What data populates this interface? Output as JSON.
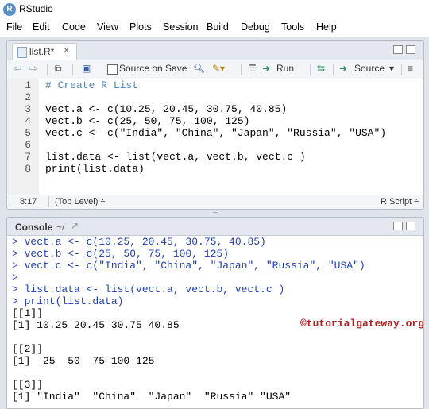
{
  "app": {
    "title": "RStudio",
    "icon_letter": "R"
  },
  "menu": [
    "File",
    "Edit",
    "Code",
    "View",
    "Plots",
    "Session",
    "Build",
    "Debug",
    "Tools",
    "Help"
  ],
  "editor": {
    "tab_label": "list.R*",
    "toolbar": {
      "source_on_save": "Source on Save",
      "run": "Run",
      "source": "Source"
    },
    "line_numbers": [
      "1",
      "2",
      "3",
      "4",
      "5",
      "6",
      "7",
      "8"
    ],
    "code_lines": [
      "# Create R List",
      "",
      "vect.a <- c(10.25, 20.45, 30.75, 40.85)",
      "vect.b <- c(25, 50, 75, 100, 125)",
      "vect.c <- c(\"India\", \"China\", \"Japan\", \"Russia\", \"USA\")",
      "",
      "list.data <- list(vect.a, vect.b, vect.c )",
      "print(list.data)"
    ],
    "status": {
      "position": "8:17",
      "scope": "(Top Level) ÷",
      "file_type": "R Script ÷"
    }
  },
  "console": {
    "title": "Console",
    "path": "~/",
    "lines": [
      {
        "type": "cmd",
        "text": "> vect.a <- c(10.25, 20.45, 30.75, 40.85)"
      },
      {
        "type": "cmd",
        "text": "> vect.b <- c(25, 50, 75, 100, 125)"
      },
      {
        "type": "cmd",
        "text": "> vect.c <- c(\"India\", \"China\", \"Japan\", \"Russia\", \"USA\")"
      },
      {
        "type": "cmd",
        "text": ">"
      },
      {
        "type": "cmd",
        "text": "> list.data <- list(vect.a, vect.b, vect.c )"
      },
      {
        "type": "cmd",
        "text": "> print(list.data)"
      },
      {
        "type": "out",
        "text": "[[1]]"
      },
      {
        "type": "out",
        "text": "[1] 10.25 20.45 30.75 40.85"
      },
      {
        "type": "out",
        "text": ""
      },
      {
        "type": "out",
        "text": "[[2]]"
      },
      {
        "type": "out",
        "text": "[1]  25  50  75 100 125"
      },
      {
        "type": "out",
        "text": ""
      },
      {
        "type": "out",
        "text": "[[3]]"
      },
      {
        "type": "out",
        "text": "[1] \"India\"  \"China\"  \"Japan\"  \"Russia\" \"USA\""
      }
    ],
    "watermark": "©tutorialgateway.org"
  }
}
